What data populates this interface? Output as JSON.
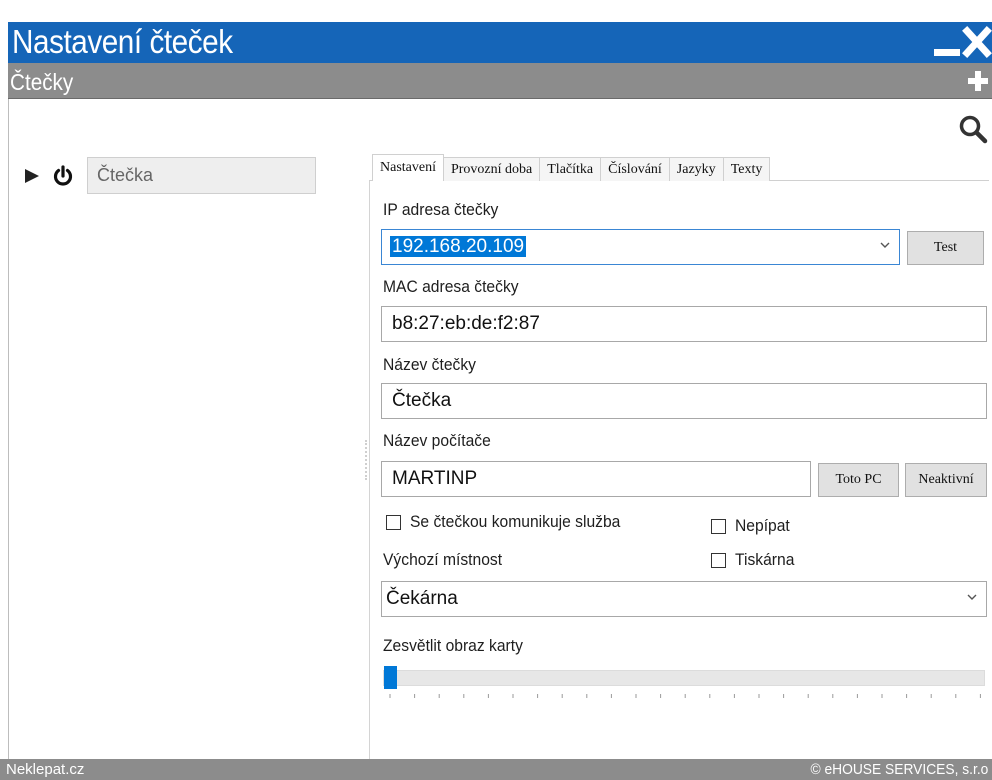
{
  "window": {
    "title": "Nastavení čteček",
    "section": "Čtečky"
  },
  "reader_list": {
    "items": [
      {
        "name": "Čtečka"
      }
    ]
  },
  "tabs": [
    {
      "label": "Nastavení",
      "active": true
    },
    {
      "label": "Provozní doba",
      "active": false
    },
    {
      "label": "Tlačítka",
      "active": false
    },
    {
      "label": "Číslování",
      "active": false
    },
    {
      "label": "Jazyky",
      "active": false
    },
    {
      "label": "Texty",
      "active": false
    }
  ],
  "form": {
    "ip_label": "IP adresa čtečky",
    "ip_value": "192.168.20.109",
    "test_button": "Test",
    "mac_label": "MAC adresa čtečky",
    "mac_value": "b8:27:eb:de:f2:87",
    "name_label": "Název čtečky",
    "name_value": "Čtečka",
    "pc_label": "Název počítače",
    "pc_value": "MARTINP",
    "this_pc_button": "Toto PC",
    "inactive_button": "Neaktivní",
    "service_checkbox": {
      "label": "Se čtečkou komunikuje služba",
      "checked": false
    },
    "no_beep_checkbox": {
      "label": "Nepípat",
      "checked": false
    },
    "printer_checkbox": {
      "label": "Tiskárna",
      "checked": false
    },
    "room_label": "Výchozí místnost",
    "room_value": "Čekárna",
    "brighten_label": "Zesvětlit obraz karty",
    "brighten_level": 0
  },
  "footer": {
    "left": "Neklepat.cz",
    "right": "© eHOUSE SERVICES, s.r.o"
  },
  "colors": {
    "title_bar": "#1565b8",
    "sub_bar": "#8c8c8c",
    "accent": "#0078d7"
  },
  "icons": {
    "minimize": "minimize-icon",
    "close": "close-icon",
    "add": "plus-icon",
    "search": "search-icon",
    "expand": "triangle-right-icon",
    "power": "power-icon",
    "dropdown": "chevron-down-icon"
  }
}
